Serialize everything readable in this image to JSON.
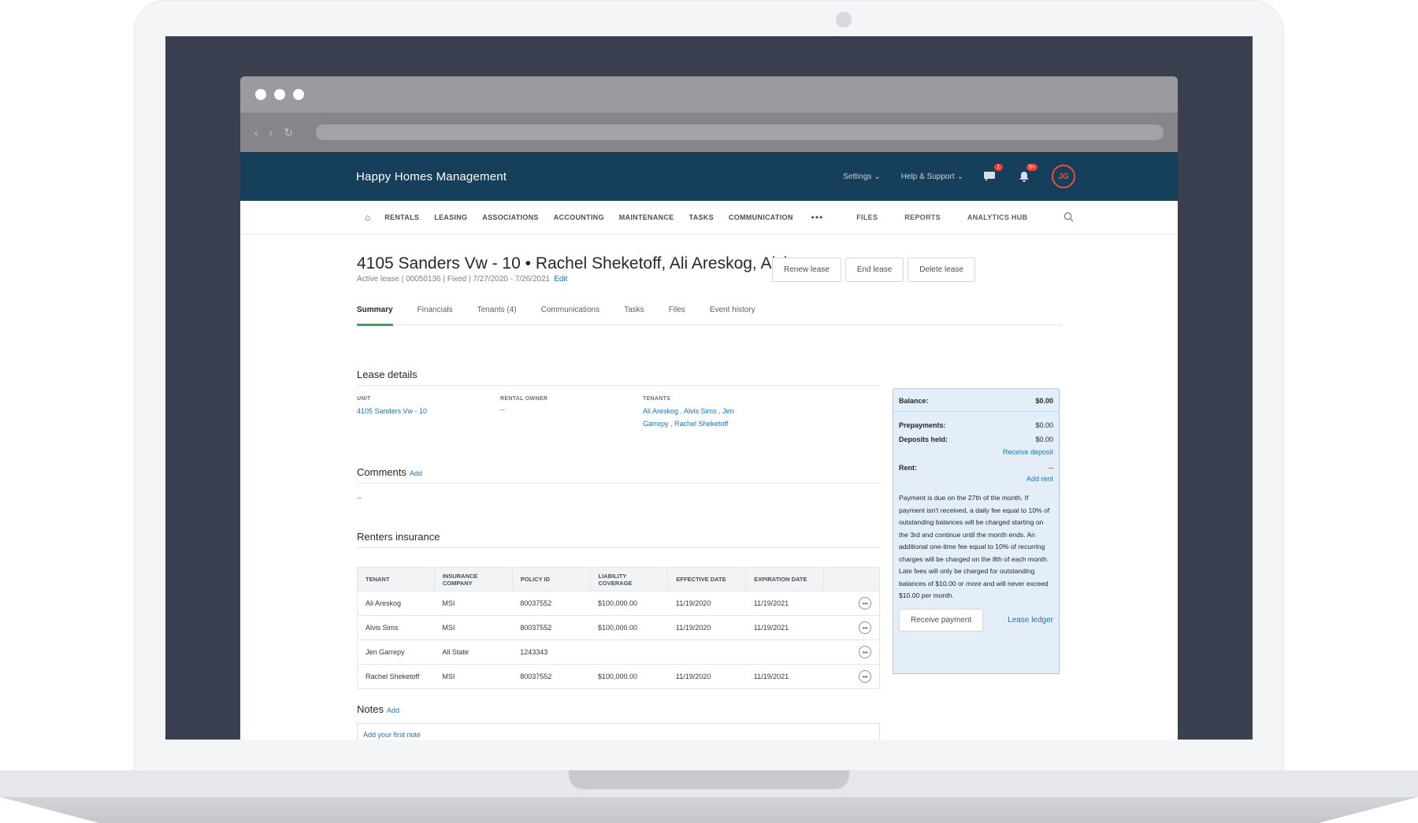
{
  "app": {
    "title": "Happy Homes Management",
    "settings_label": "Settings",
    "help_label": "Help & Support",
    "messages_badge": "1",
    "notifications_badge": "5+",
    "avatar_initials": "JG"
  },
  "nav": {
    "items": [
      "RENTALS",
      "LEASING",
      "ASSOCIATIONS",
      "ACCOUNTING",
      "MAINTENANCE",
      "TASKS",
      "COMMUNICATION"
    ],
    "more": "•••",
    "right_items": [
      "FILES",
      "REPORTS",
      "ANALYTICS HUB"
    ]
  },
  "lease": {
    "title": "4105 Sanders Vw - 10 • Rachel Sheketoff, Ali Areskog, Alvis...",
    "subtitle": "Active lease | 00050136 | Fixed | 7/27/2020 - 7/26/2021",
    "edit_label": "Edit",
    "buttons": {
      "renew": "Renew lease",
      "end": "End lease",
      "delete": "Delete lease"
    }
  },
  "tabs": [
    "Summary",
    "Financials",
    "Tenants (4)",
    "Communications",
    "Tasks",
    "Files",
    "Event history"
  ],
  "lease_details": {
    "title": "Lease details",
    "unit_label": "UNIT",
    "unit_value": "4105 Sanders Vw - 10",
    "owner_label": "RENTAL OWNER",
    "owner_value": "--",
    "tenants_label": "TENANTS",
    "tenants_line1": "Ali Areskog , Alvis Sims , Jen",
    "tenants_line2": "Garrepy , Rachel Sheketoff"
  },
  "comments": {
    "title": "Comments",
    "add": "Add",
    "value": "--"
  },
  "renters_insurance": {
    "title": "Renters insurance",
    "columns": [
      "TENANT",
      "INSURANCE COMPANY",
      "POLICY ID",
      "LIABILITY COVERAGE",
      "EFFECTIVE DATE",
      "EXPIRATION DATE"
    ],
    "rows": [
      [
        "Ali Areskog",
        "MSI",
        "80037552",
        "$100,000.00",
        "11/19/2020",
        "11/19/2021"
      ],
      [
        "Alvis Sims",
        "MSI",
        "80037552",
        "$100,000.00",
        "11/19/2020",
        "11/19/2021"
      ],
      [
        "Jen Garrepy",
        "All State",
        "1243343",
        "",
        "",
        ""
      ],
      [
        "Rachel Sheketoff",
        "MSI",
        "80037552",
        "$100,000.00",
        "11/19/2020",
        "11/19/2021"
      ]
    ],
    "row_menu": "•••"
  },
  "notes": {
    "title": "Notes",
    "add": "Add",
    "placeholder": "Add your first note"
  },
  "balance": {
    "balance_label": "Balance:",
    "balance_value": "$0.00",
    "prepayments_label": "Prepayments:",
    "prepayments_value": "$0.00",
    "deposits_label": "Deposits held:",
    "deposits_value": "$0.00",
    "receive_deposit": "Receive deposit",
    "rent_label": "Rent:",
    "rent_value": "--",
    "add_rent": "Add rent",
    "policy_text": "Payment is due on the 27th of the month. If payment isn't received, a daily fee equal to 10% of outstanding balances will be charged starting on the 3rd and continue until the month ends. An additional one-time fee equal to 10% of recurring charges will be charged on the 8th of each month. Late fees will only be charged for outstanding balances of $10.00 or more and will never exceed $10.00 per month.",
    "receive_payment": "Receive payment",
    "lease_ledger": "Lease ledger"
  },
  "colors": {
    "header_bg": "#163f5c",
    "link": "#1f72b8",
    "active_tab": "#3ea55f",
    "badge": "#e8413a",
    "card_bg": "#e3eef8"
  }
}
